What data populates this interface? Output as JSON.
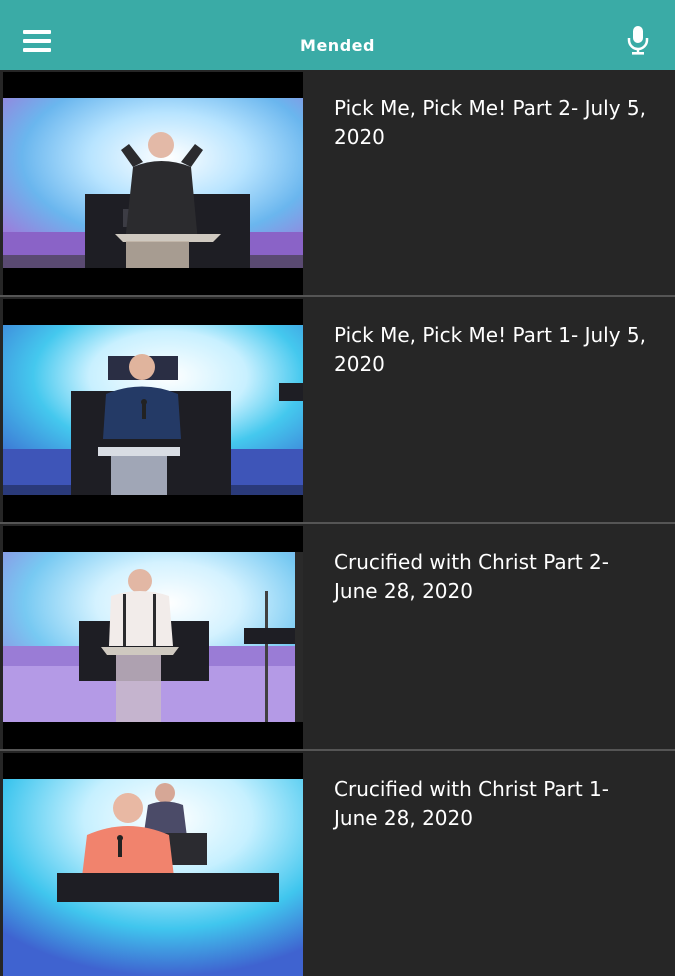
{
  "header": {
    "title": "Mended",
    "menu_icon": "hamburger-menu-icon",
    "mic_icon": "microphone-icon"
  },
  "colors": {
    "accent": "#3aaba6",
    "list_background": "#262626"
  },
  "videos": [
    {
      "title": "Pick Me, Pick Me! Part 2- July 5, 2020"
    },
    {
      "title": "Pick Me, Pick Me! Part 1- July 5, 2020"
    },
    {
      "title": "Crucified with Christ Part 2- June 28, 2020"
    },
    {
      "title": "Crucified with Christ Part 1- June 28, 2020"
    }
  ]
}
